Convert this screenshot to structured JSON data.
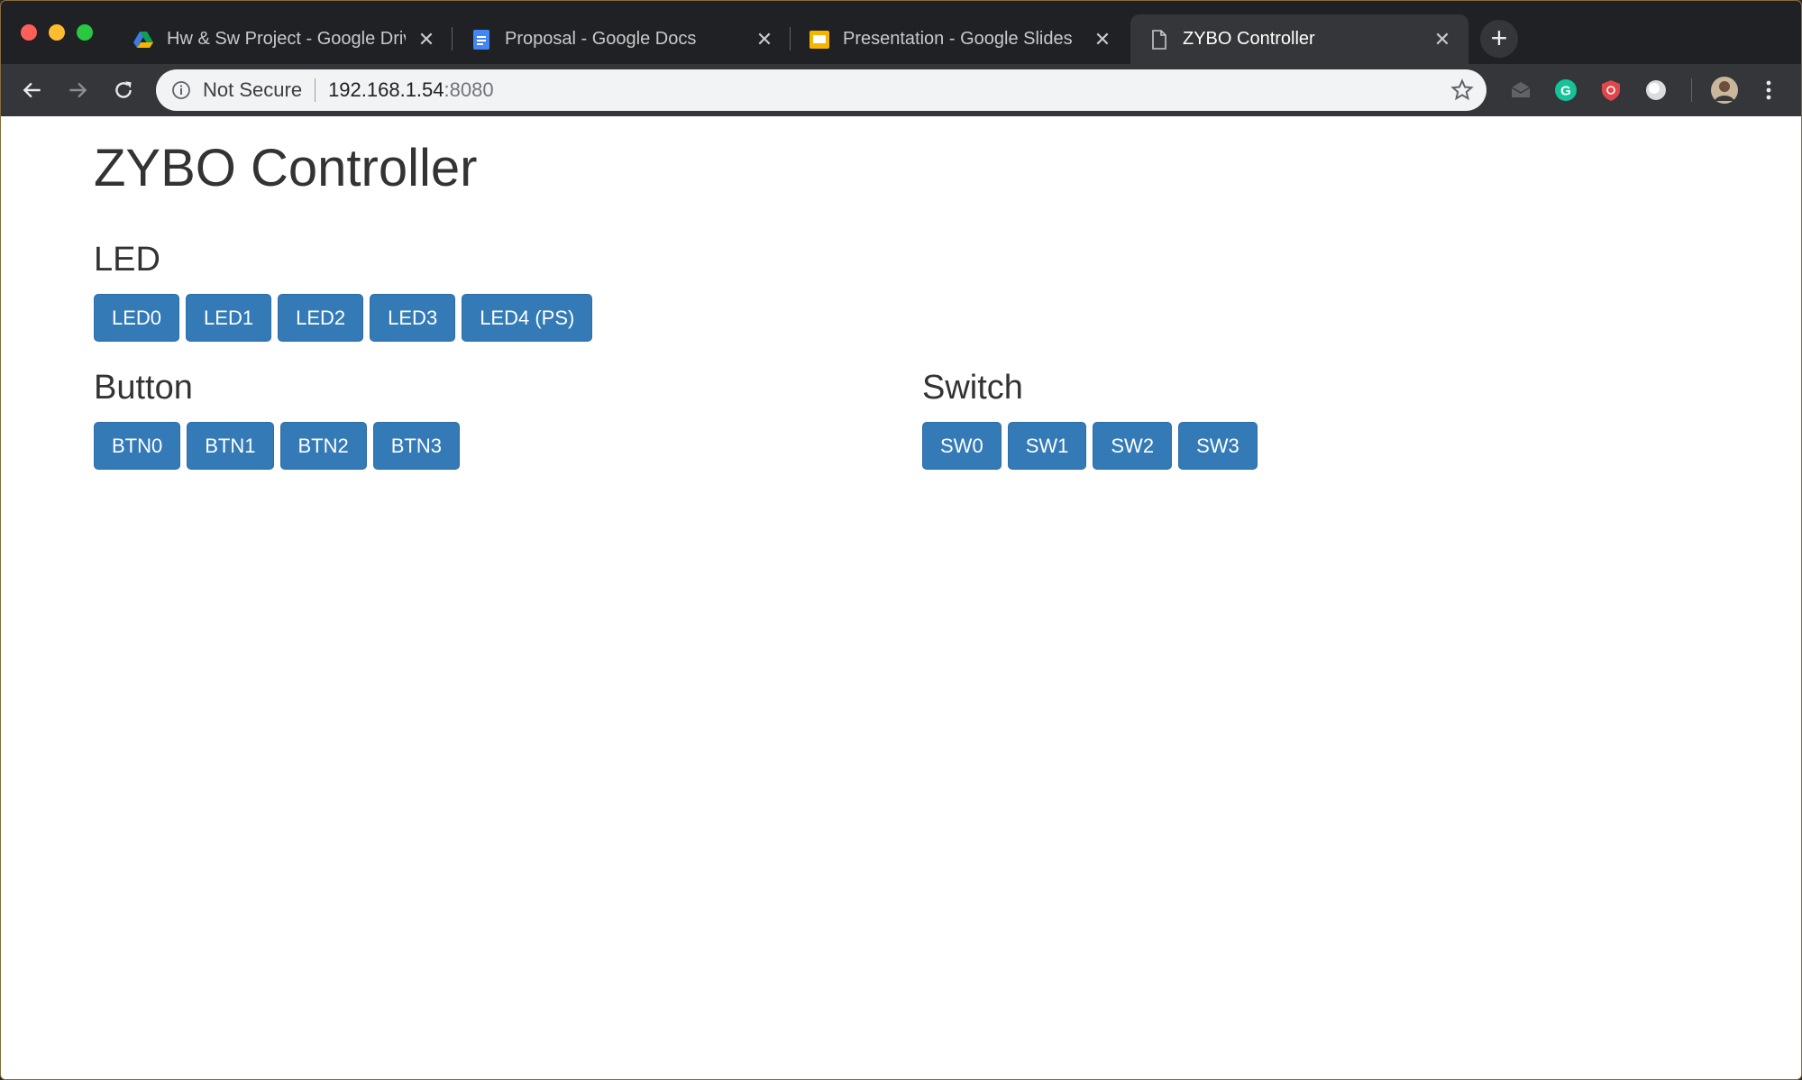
{
  "browser": {
    "tabs": [
      {
        "title": "Hw & Sw Project - Google Driv",
        "icon": "google-drive-icon",
        "active": false
      },
      {
        "title": "Proposal - Google Docs",
        "icon": "google-docs-icon",
        "active": false
      },
      {
        "title": "Presentation - Google Slides",
        "icon": "google-slides-icon",
        "active": false
      },
      {
        "title": "ZYBO Controller",
        "icon": "page-icon",
        "active": true
      }
    ],
    "address": {
      "security_label": "Not Secure",
      "host": "192.168.1.54",
      "port": ":8080"
    }
  },
  "page": {
    "title": "ZYBO Controller",
    "led": {
      "heading": "LED",
      "buttons": [
        "LED0",
        "LED1",
        "LED2",
        "LED3",
        "LED4 (PS)"
      ]
    },
    "button": {
      "heading": "Button",
      "buttons": [
        "BTN0",
        "BTN1",
        "BTN2",
        "BTN3"
      ]
    },
    "switch": {
      "heading": "Switch",
      "buttons": [
        "SW0",
        "SW1",
        "SW2",
        "SW3"
      ]
    }
  },
  "colors": {
    "primary_button": "#337ab7",
    "tabstrip": "#202124",
    "toolbar": "#35363a"
  }
}
